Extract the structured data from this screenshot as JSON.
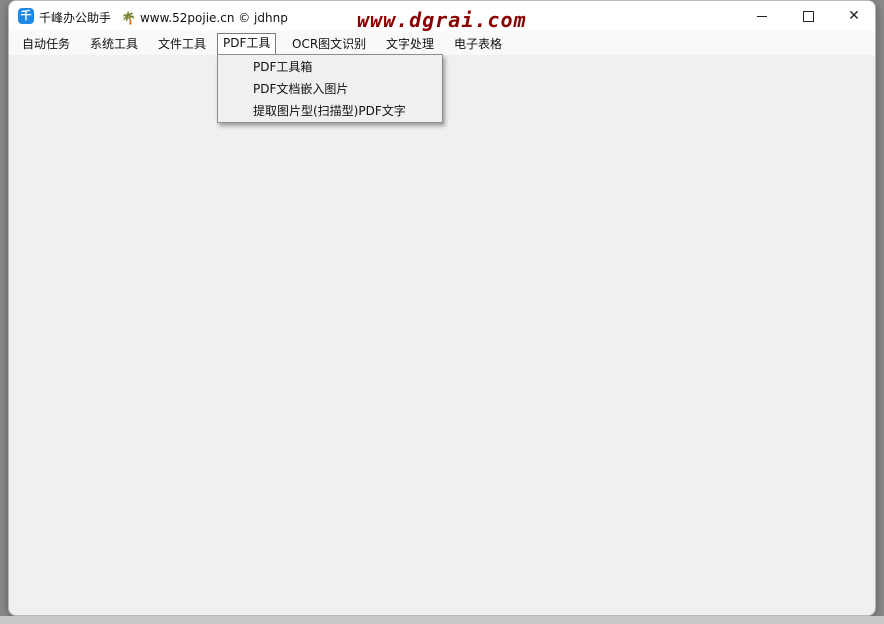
{
  "window": {
    "app_icon_glyph": "千",
    "app_name": "千峰办公助手",
    "site_icon": "plant-icon",
    "site_icon_glyph": "🌴",
    "site_info": "www.52pojie.cn © jdhnp",
    "watermark": "www.dgrai.com",
    "controls": {
      "minimize": "minimize-icon",
      "maximize": "maximize-icon",
      "close": "close-icon",
      "close_glyph": "✕"
    }
  },
  "menubar": {
    "items": [
      {
        "label": "自动任务"
      },
      {
        "label": "系统工具"
      },
      {
        "label": "文件工具"
      },
      {
        "label": "PDF工具",
        "active": true
      },
      {
        "label": "OCR图文识别"
      },
      {
        "label": "文字处理"
      },
      {
        "label": "电子表格"
      }
    ]
  },
  "dropdown": {
    "parent": "PDF工具",
    "items": [
      {
        "label": "PDF工具箱"
      },
      {
        "label": "PDF文档嵌入图片"
      },
      {
        "label": "提取图片型(扫描型)PDF文字"
      }
    ]
  },
  "colors": {
    "window_bg": "#f0f0f0",
    "titlebar_bg": "#ffffff",
    "watermark": "#8b0000",
    "app_icon": "#1e88e5"
  }
}
